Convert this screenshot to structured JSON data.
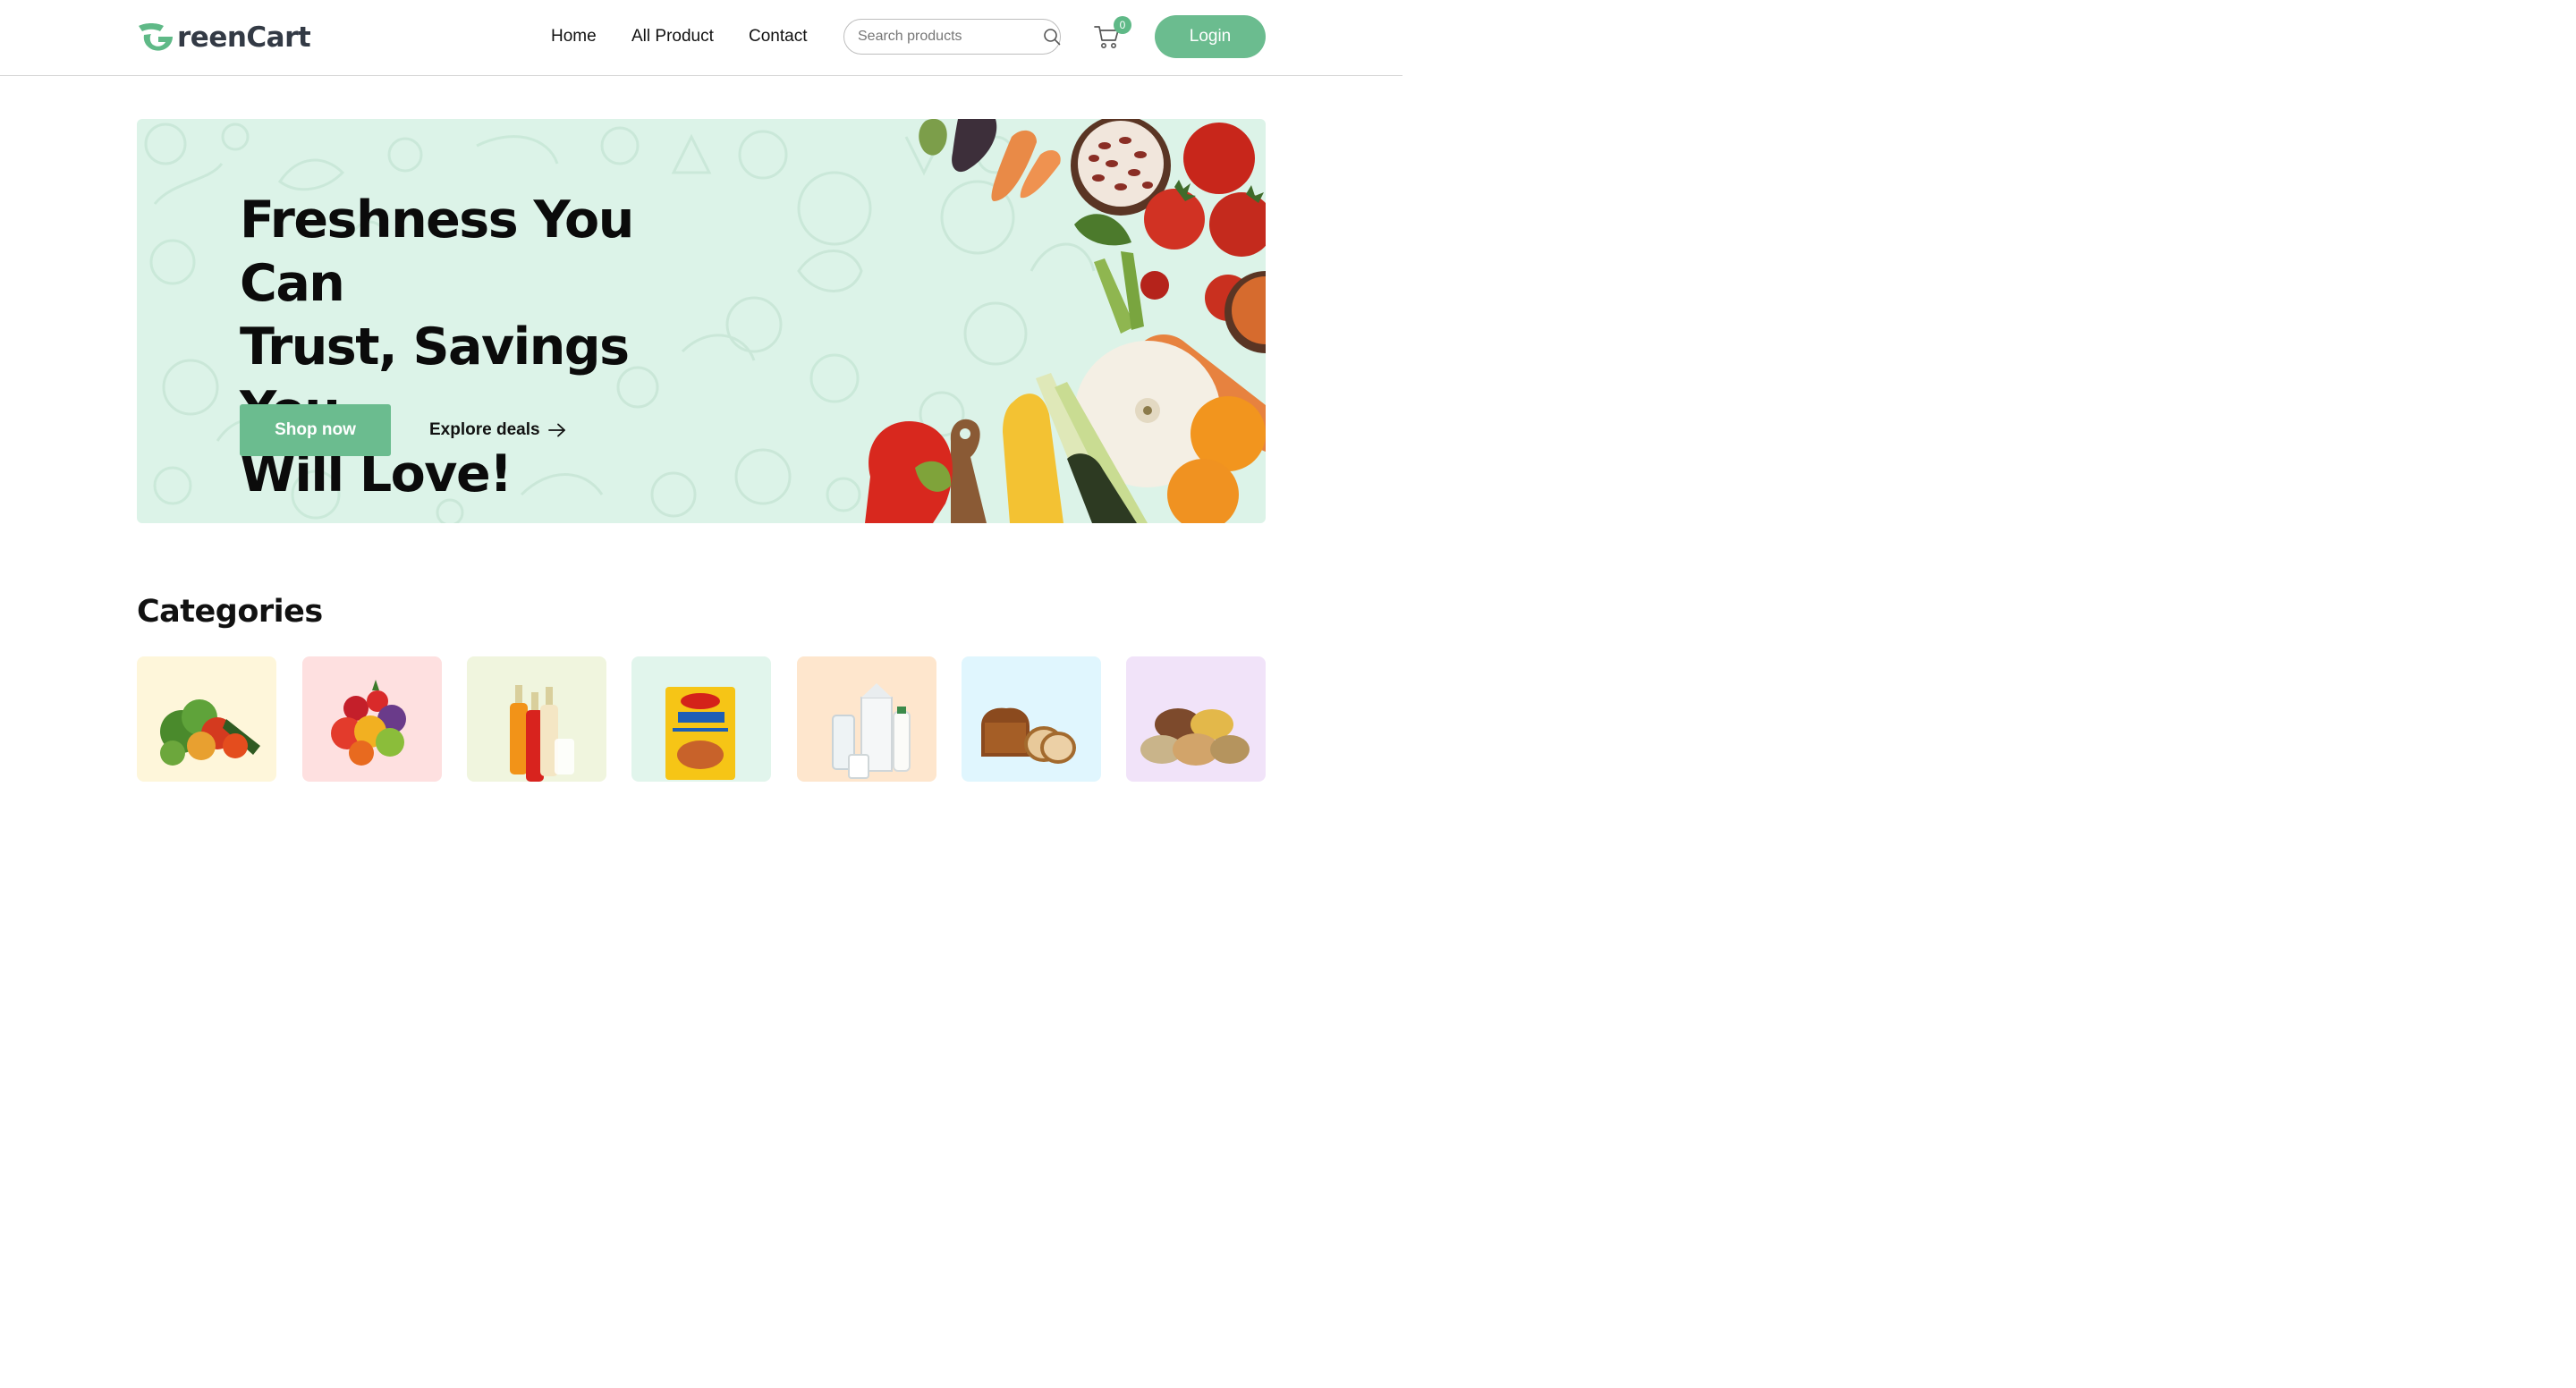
{
  "brand": {
    "name": "GreenCart",
    "name_rest": "reenCart",
    "accent_color": "#6bbc8f"
  },
  "nav": {
    "links": [
      {
        "label": "Home"
      },
      {
        "label": "All Product"
      },
      {
        "label": "Contact"
      }
    ],
    "search": {
      "placeholder": "Search products",
      "icon": "search-icon"
    },
    "cart": {
      "icon": "cart-icon",
      "count": "0"
    },
    "login_label": "Login"
  },
  "hero": {
    "title_lines": [
      "Freshness You Can",
      "Trust, Savings You",
      "Will Love!"
    ],
    "background_color": "#dcf3e8",
    "primary_button": "Shop now",
    "secondary_link": "Explore deals",
    "secondary_icon": "arrow-right-icon"
  },
  "categories": {
    "title": "Categories",
    "items": [
      {
        "icon": "vegetables-image",
        "bg": "#fef6da"
      },
      {
        "icon": "fruits-image",
        "bg": "#fee0e0"
      },
      {
        "icon": "drinks-image",
        "bg": "#f0f5de"
      },
      {
        "icon": "instant-food-image",
        "bg": "#e1f5ec"
      },
      {
        "icon": "dairy-image",
        "bg": "#fee6cd"
      },
      {
        "icon": "bakery-image",
        "bg": "#e0f6fe"
      },
      {
        "icon": "grains-image",
        "bg": "#f1e3f9"
      }
    ]
  }
}
